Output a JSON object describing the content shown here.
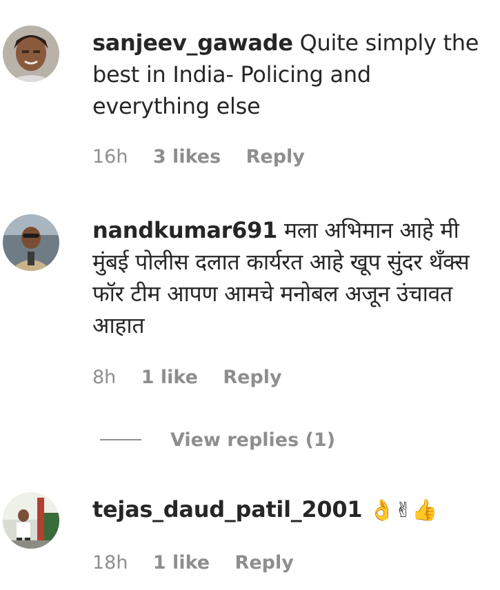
{
  "comments": [
    {
      "username": "sanjeev_gawade",
      "text": "Quite simply the best in India- Policing and everything else",
      "time": "16h",
      "likes": "3 likes",
      "reply_label": "Reply",
      "avatar_icon": "user-avatar-icon"
    },
    {
      "username": "nandkumar691",
      "text": "मला अभिमान आहे मी मुंबई पोलीस दलात कार्यरत आहे खूप सुंदर थँक्स फॉर टीम आपण आमचे मनोबल अजून उंचावत आहात",
      "time": "8h",
      "likes": "1 like",
      "reply_label": "Reply",
      "avatar_icon": "user-avatar-icon"
    },
    {
      "username": "tejas_daud_patil_2001",
      "text": "👌✌👍",
      "time": "18h",
      "likes": "1 like",
      "reply_label": "Reply",
      "avatar_icon": "user-avatar-icon"
    }
  ],
  "view_replies": {
    "label": "View replies (1)"
  },
  "colors": {
    "text": "#262626",
    "muted": "#8e8e8e",
    "background": "#ffffff"
  }
}
